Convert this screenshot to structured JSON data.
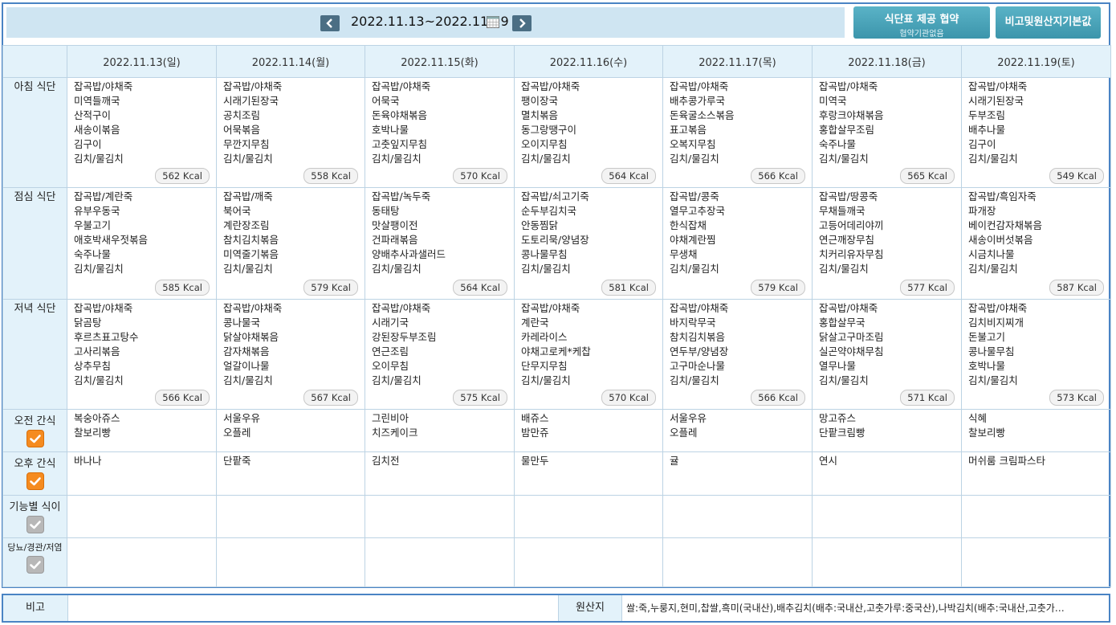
{
  "header": {
    "week_range": "2022.11.13~2022.11.19",
    "prev_icon": "chevron-left",
    "next_icon": "chevron-right",
    "calendar_icon": "calendar",
    "contract_button": {
      "title": "식단표 제공 협약",
      "subtitle": "협약기관없음"
    },
    "notes_button": "비고및원산지기본값"
  },
  "days": [
    "2022.11.13(일)",
    "2022.11.14(월)",
    "2022.11.15(화)",
    "2022.11.16(수)",
    "2022.11.17(목)",
    "2022.11.18(금)",
    "2022.11.19(토)"
  ],
  "meals": [
    {
      "label": "아침 식단",
      "cells": [
        {
          "items": [
            "잡곡밥/야채죽",
            "미역들깨국",
            "산적구이",
            "새송이볶음",
            "김구이",
            "김치/물김치"
          ],
          "kcal": "562 Kcal"
        },
        {
          "items": [
            "잡곡밥/야채죽",
            "시래기된장국",
            "공치조림",
            "어묵볶음",
            "무깐지무침",
            "김치/물김치"
          ],
          "kcal": "558 Kcal"
        },
        {
          "items": [
            "잡곡밥/야채죽",
            "어묵국",
            "돈육야채볶음",
            "호박나물",
            "고춧잎지무침",
            "김치/물김치"
          ],
          "kcal": "570 Kcal"
        },
        {
          "items": [
            "잡곡밥/야채죽",
            "팽이장국",
            "멸치볶음",
            "동그랑땡구이",
            "오이지무침",
            "김치/물김치"
          ],
          "kcal": "564 Kcal"
        },
        {
          "items": [
            "잡곡밥/야채죽",
            "배추콩가루국",
            "돈육굴소스볶음",
            "표고볶음",
            "오복지무침",
            "김치/물김치"
          ],
          "kcal": "566 Kcal"
        },
        {
          "items": [
            "잡곡밥/야채죽",
            "미역국",
            "후랑크야채볶음",
            "홍합살무조림",
            "숙주나물",
            "김치/물김치"
          ],
          "kcal": "565 Kcal"
        },
        {
          "items": [
            "잡곡밥/야채죽",
            "시래기된장국",
            "두부조림",
            "배추나물",
            "김구이",
            "김치/물김치"
          ],
          "kcal": "549 Kcal"
        }
      ]
    },
    {
      "label": "점심 식단",
      "cells": [
        {
          "items": [
            "잡곡밥/계란죽",
            "유부우동국",
            "우불고기",
            "애호박새우젓볶음",
            "숙주나물",
            "김치/물김치"
          ],
          "kcal": "585 Kcal"
        },
        {
          "items": [
            "잡곡밥/깨죽",
            "북어국",
            "계란장조림",
            "참치김치볶음",
            "미역줄기볶음",
            "김치/물김치"
          ],
          "kcal": "579 Kcal"
        },
        {
          "items": [
            "잡곡밥/녹두죽",
            "동태탕",
            "맛살팽이전",
            "건파래볶음",
            "양배추사과샐러드",
            "김치/물김치"
          ],
          "kcal": "564 Kcal"
        },
        {
          "items": [
            "잡곡밥/쇠고기죽",
            "순두부김치국",
            "안동찜닭",
            "도토리묵/양념장",
            "콩나물무침",
            "김치/물김치"
          ],
          "kcal": "581 Kcal"
        },
        {
          "items": [
            "잡곡밥/콩죽",
            "열무고추장국",
            "한식잡채",
            "야채계란찜",
            "무생채",
            "김치/물김치"
          ],
          "kcal": "579 Kcal"
        },
        {
          "items": [
            "잡곡밥/땅콩죽",
            "무채들깨국",
            "고등어데리야끼",
            "연근깨장무침",
            "치커리유자무침",
            "김치/물김치"
          ],
          "kcal": "577 Kcal"
        },
        {
          "items": [
            "잡곡밥/흑임자죽",
            "파개장",
            "베이컨감자채볶음",
            "새송이버섯볶음",
            "시금치나물",
            "김치/물김치"
          ],
          "kcal": "587 Kcal"
        }
      ]
    },
    {
      "label": "저녁 식단",
      "cells": [
        {
          "items": [
            "잡곡밥/야채죽",
            "닭곰탕",
            "후르츠표고탕수",
            "고사리볶음",
            "상추무침",
            "김치/물김치"
          ],
          "kcal": "566 Kcal"
        },
        {
          "items": [
            "잡곡밥/야채죽",
            "콩나물국",
            "닭살야채볶음",
            "감자채볶음",
            "얼갈이나물",
            "김치/물김치"
          ],
          "kcal": "567 Kcal"
        },
        {
          "items": [
            "잡곡밥/야채죽",
            "시래기국",
            "강된장두부조림",
            "연근조림",
            "오이무침",
            "김치/물김치"
          ],
          "kcal": "575 Kcal"
        },
        {
          "items": [
            "잡곡밥/야채죽",
            "계란국",
            "카레라이스",
            "야채고로케*케찹",
            "단무지무침",
            "김치/물김치"
          ],
          "kcal": "570 Kcal"
        },
        {
          "items": [
            "잡곡밥/야채죽",
            "바지락무국",
            "참치김치볶음",
            "연두부/양념장",
            "고구마순나물",
            "김치/물김치"
          ],
          "kcal": "566 Kcal"
        },
        {
          "items": [
            "잡곡밥/야채죽",
            "홍합살무국",
            "닭살고구마조림",
            "실곤약야채무침",
            "열무나물",
            "김치/물김치"
          ],
          "kcal": "571 Kcal"
        },
        {
          "items": [
            "잡곡밥/야채죽",
            "김치비지찌개",
            "돈불고기",
            "콩나물무침",
            "호박나물",
            "김치/물김치"
          ],
          "kcal": "573 Kcal"
        }
      ]
    }
  ],
  "snacks": [
    {
      "label": "오전 간식",
      "checked": true,
      "cells": [
        [
          "복숭아쥬스",
          "찰보리빵"
        ],
        [
          "서울우유",
          "오플레"
        ],
        [
          "그린비아",
          "치즈케이크"
        ],
        [
          "배쥬스",
          "밤만쥬"
        ],
        [
          "서울우유",
          "오플레"
        ],
        [
          "망고쥬스",
          "단팥크림빵"
        ],
        [
          "식혜",
          "찰보리빵"
        ]
      ]
    },
    {
      "label": "오후 간식",
      "checked": true,
      "cells": [
        [
          "바나나"
        ],
        [
          "단팥죽"
        ],
        [
          "김치전"
        ],
        [
          "물만두"
        ],
        [
          "귤"
        ],
        [
          "연시"
        ],
        [
          "머쉬룸 크림파스타"
        ]
      ]
    },
    {
      "label": "기능별 식이",
      "checked": false,
      "cells": [
        [],
        [],
        [],
        [],
        [],
        [],
        []
      ]
    },
    {
      "label": "당뇨/경관/저염",
      "checked": false,
      "cells": [
        [],
        [],
        [],
        [],
        [],
        [],
        []
      ]
    }
  ],
  "footer": {
    "remarks_label": "비고",
    "remarks_value": "",
    "origin_label": "원산지",
    "origin_value": "쌀:죽,누룽지,현미,찹쌀,흑미(국내산),배추김치(배추:국내산,고춧가루:중국산),나박김치(배추:국내산,고춧가…"
  },
  "colors": {
    "accent": "#4a84c4",
    "header_bg": "#e3f2fa",
    "sunday": "#d23a3a",
    "saturday": "#2b4fc9",
    "checkbox_on": "#f58b1f",
    "checkbox_off": "#b8b8b8",
    "button": "#4aa4ba"
  }
}
